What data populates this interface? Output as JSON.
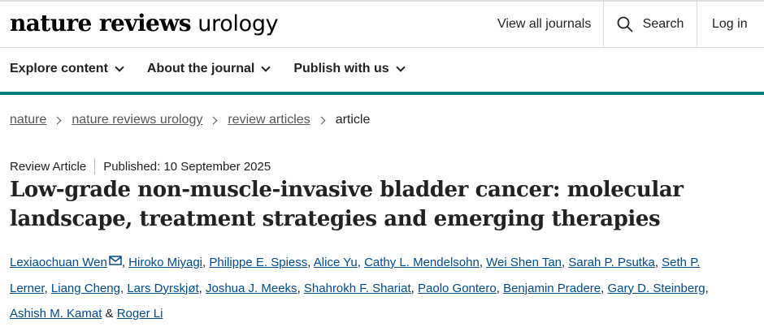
{
  "header": {
    "logo_bold": "nature reviews",
    "logo_light": "urology",
    "view_all_journals": "View all journals",
    "search_label": "Search",
    "login_label": "Log in"
  },
  "nav": {
    "items": [
      "Explore content",
      "About the journal",
      "Publish with us"
    ]
  },
  "breadcrumb": {
    "items": [
      "nature",
      "nature reviews urology",
      "review articles"
    ],
    "current": "article"
  },
  "article": {
    "type": "Review Article",
    "published": "Published: 10 September 2025",
    "title": "Low-grade non-muscle-invasive bladder cancer: molecular landscape, treatment strategies and emerging therapies",
    "authors": [
      "Lexiaochuan Wen",
      "Hiroko Miyagi",
      "Philippe E. Spiess",
      "Alice Yu",
      "Cathy L. Mendelsohn",
      "Wei Shen Tan",
      "Sarah P. Psutka",
      "Seth P. Lerner",
      "Liang Cheng",
      "Lars Dyrskjøt",
      "Joshua J. Meeks",
      "Shahrokh F. Shariat",
      "Paolo Gontero",
      "Benjamin Pradere",
      "Gary D. Steinberg",
      "Ashish M. Kamat",
      "Roger Li"
    ],
    "authors_separator": ",",
    "authors_last_joiner": "&"
  },
  "colors": {
    "accent_teal": "#008080",
    "link_blue": "#024b8a"
  },
  "icons": {
    "search": "search-icon",
    "chevron": "chevron-down-icon",
    "mail": "mail-icon",
    "breadcrumb_separator": "chevron-right-icon"
  }
}
